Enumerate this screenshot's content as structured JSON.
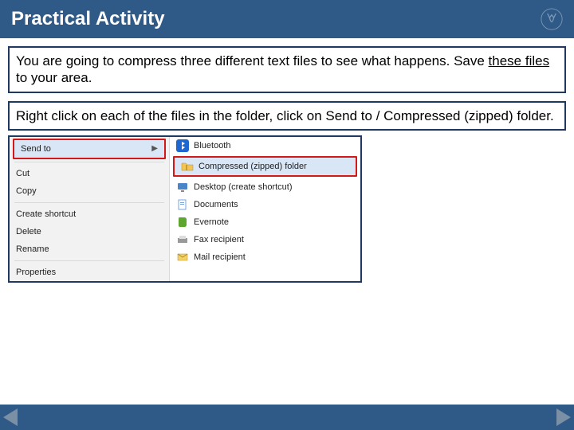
{
  "title": "Practical Activity",
  "box1_a": "You are going to compress three different text files to see what happens. Save ",
  "box1_link": "these files",
  "box1_b": " to your area.",
  "box2": "Right click on each of the files in the folder, click on Send to / Compressed (zipped) folder.",
  "leftMenu": {
    "sendto": "Send to",
    "cut": "Cut",
    "copy": "Copy",
    "shortcut": "Create shortcut",
    "delete": "Delete",
    "rename": "Rename",
    "properties": "Properties"
  },
  "rightMenu": {
    "bluetooth": "Bluetooth",
    "compressed": "Compressed (zipped) folder",
    "desktop": "Desktop (create shortcut)",
    "documents": "Documents",
    "evernote": "Evernote",
    "fax": "Fax recipient",
    "mail": "Mail recipient"
  }
}
